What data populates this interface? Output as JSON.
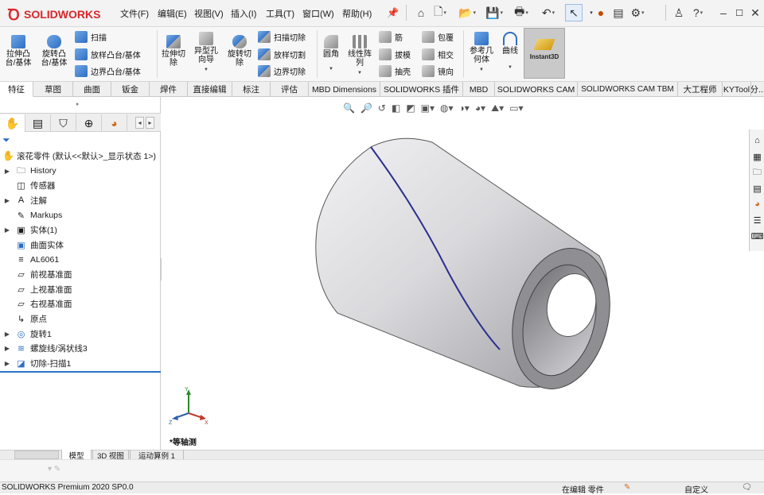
{
  "app": {
    "logo_text": "SOLIDWORKS",
    "menus": [
      "文件(F)",
      "编辑(E)",
      "视图(V)",
      "插入(I)",
      "工具(T)",
      "窗口(W)",
      "帮助(H)"
    ]
  },
  "quick_access": [
    "home-icon",
    "new-doc-icon",
    "open-icon",
    "save-icon",
    "print-icon",
    "undo-icon",
    "select-icon",
    "rebuild-icon",
    "file-props-icon",
    "options-icon",
    "user-icon",
    "help-icon",
    "minimize-icon",
    "restore-icon",
    "close-icon"
  ],
  "ribbon": {
    "extrude_boss": "拉伸凸\n台/基体",
    "revolve_boss": "旋转凸\n台/基体",
    "sweep": "扫描",
    "loft_boss": "放样凸台/基体",
    "boundary_boss": "边界凸台/基体",
    "extrude_cut": "拉伸切\n除",
    "hole_wizard": "异型孔\n向导",
    "revolve_cut": "旋转切\n除",
    "swept_cut": "扫描切除",
    "lofted_cut": "放样切割",
    "boundary_cut": "边界切除",
    "fillet": "圆角",
    "linear_pattern": "线性阵\n列",
    "rib": "筋",
    "draft": "拔模",
    "shell": "抽壳",
    "wrap": "包覆",
    "intersect": "相交",
    "mirror": "镜向",
    "ref_geometry": "参考几\n何体",
    "curves": "曲线",
    "instant3d": "Instant3D"
  },
  "tabs": [
    "特征",
    "草图",
    "曲面",
    "钣金",
    "焊件",
    "直接编辑",
    "标注",
    "评估",
    "MBD Dimensions",
    "SOLIDWORKS 插件",
    "MBD",
    "SOLIDWORKS CAM",
    "SOLIDWORKS CAM TBM",
    "大工程师",
    "KYTool",
    "分..."
  ],
  "feature_tree": {
    "root": "滚花零件 (默认<<默认>_显示状态 1>)",
    "items": [
      {
        "label": "History",
        "expandable": true,
        "icon": "history-icon"
      },
      {
        "label": "传感器",
        "expandable": false,
        "icon": "sensor-icon"
      },
      {
        "label": "注解",
        "expandable": true,
        "icon": "annotation-icon"
      },
      {
        "label": "Markups",
        "expandable": false,
        "icon": "markup-icon"
      },
      {
        "label": "实体(1)",
        "expandable": true,
        "icon": "solid-body-icon"
      },
      {
        "label": "曲面实体",
        "expandable": false,
        "icon": "surface-body-icon"
      },
      {
        "label": "AL6061",
        "expandable": false,
        "icon": "material-icon"
      },
      {
        "label": "前视基准面",
        "expandable": false,
        "icon": "plane-icon"
      },
      {
        "label": "上视基准面",
        "expandable": false,
        "icon": "plane-icon"
      },
      {
        "label": "右视基准面",
        "expandable": false,
        "icon": "plane-icon"
      },
      {
        "label": "原点",
        "expandable": false,
        "icon": "origin-icon"
      },
      {
        "label": "旋转1",
        "expandable": true,
        "icon": "revolve-icon"
      },
      {
        "label": "螺旋线/涡状线3",
        "expandable": true,
        "icon": "helix-icon"
      },
      {
        "label": "切除-扫描1",
        "expandable": true,
        "icon": "cut-sweep-icon"
      }
    ]
  },
  "viewport": {
    "view_name": "*等轴测",
    "triad_labels": {
      "x": "X",
      "y": "Y",
      "z": "Z"
    },
    "model_color": "#c9c9cc",
    "helix_color": "#2c2f8f"
  },
  "bottom_tabs": [
    "模型",
    "3D 视图",
    "运动算例 1"
  ],
  "status": {
    "product": "SOLIDWORKS Premium 2020 SP0.0",
    "editing": "在编辑 零件",
    "units": "自定义"
  }
}
